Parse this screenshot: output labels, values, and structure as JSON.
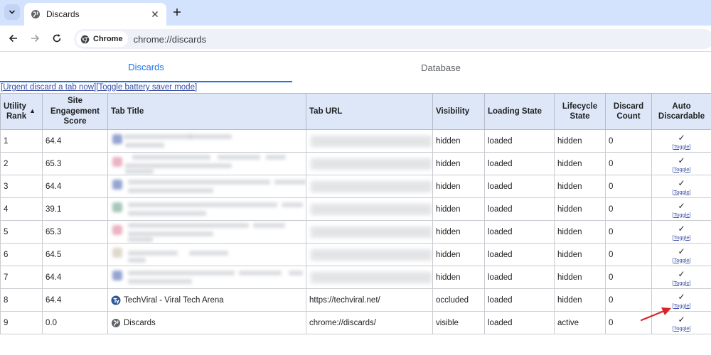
{
  "browser": {
    "tab_title": "Discards",
    "omnibox_chip": "Chrome",
    "url": "chrome://discards"
  },
  "page_tabs": [
    "Discards",
    "Database"
  ],
  "actions": {
    "urgent_discard": "[Urgent discard a tab now]",
    "toggle_battery": "[Toggle battery saver mode]"
  },
  "headers": {
    "utility_rank_1": "Utility",
    "utility_rank_2": "Rank",
    "sort_arrow": "▲",
    "engagement_1": "Site",
    "engagement_2": "Engagement",
    "engagement_3": "Score",
    "tab_title": "Tab Title",
    "tab_url": "Tab URL",
    "visibility": "Visibility",
    "loading_state": "Loading State",
    "lifecycle_1": "Lifecycle",
    "lifecycle_2": "State",
    "discard_1": "Discard",
    "discard_2": "Count",
    "auto_1": "Auto",
    "auto_2": "Discardable"
  },
  "rows": [
    {
      "rank": "1",
      "score": "64.4",
      "title": "",
      "url": "",
      "visibility": "hidden",
      "loading": "loaded",
      "lifecycle": "hidden",
      "discard_count": "0",
      "auto": "✓",
      "toggle": "[Toggle]",
      "fav_color": "#7b8fc7"
    },
    {
      "rank": "2",
      "score": "65.3",
      "title": "",
      "url": "",
      "visibility": "hidden",
      "loading": "loaded",
      "lifecycle": "hidden",
      "discard_count": "0",
      "auto": "✓",
      "toggle": "[Toggle]",
      "fav_color": "#e7a1b5"
    },
    {
      "rank": "3",
      "score": "64.4",
      "title": "",
      "url": "",
      "visibility": "hidden",
      "loading": "loaded",
      "lifecycle": "hidden",
      "discard_count": "0",
      "auto": "✓",
      "toggle": "[Toggle]",
      "fav_color": "#7b8fc7"
    },
    {
      "rank": "4",
      "score": "39.1",
      "title": "",
      "url": "",
      "visibility": "hidden",
      "loading": "loaded",
      "lifecycle": "hidden",
      "discard_count": "0",
      "auto": "✓",
      "toggle": "[Toggle]",
      "fav_color": "#8fb9a8"
    },
    {
      "rank": "5",
      "score": "65.3",
      "title": "",
      "url": "",
      "visibility": "hidden",
      "loading": "loaded",
      "lifecycle": "hidden",
      "discard_count": "0",
      "auto": "✓",
      "toggle": "[Toggle]",
      "fav_color": "#e7a1b5"
    },
    {
      "rank": "6",
      "score": "64.5",
      "title": "",
      "url": "",
      "visibility": "hidden",
      "loading": "loaded",
      "lifecycle": "hidden",
      "discard_count": "0",
      "auto": "✓",
      "toggle": "[Toggle]",
      "fav_color": "#d8d0c0"
    },
    {
      "rank": "7",
      "score": "64.4",
      "title": "",
      "url": "",
      "visibility": "hidden",
      "loading": "loaded",
      "lifecycle": "hidden",
      "discard_count": "0",
      "auto": "✓",
      "toggle": "[Toggle]",
      "fav_color": "#7b8fc7"
    },
    {
      "rank": "8",
      "score": "64.4",
      "title": "TechViral - Viral Tech Arena",
      "url": "https://techviral.net/",
      "visibility": "occluded",
      "loading": "loaded",
      "lifecycle": "hidden",
      "discard_count": "0",
      "auto": "✓",
      "toggle": "[Toggle]",
      "fav_color": "#2b5797"
    },
    {
      "rank": "9",
      "score": "0.0",
      "title": "Discards",
      "url": "chrome://discards/",
      "visibility": "visible",
      "loading": "loaded",
      "lifecycle": "active",
      "discard_count": "0",
      "auto": "✓",
      "toggle": "[Toggle]",
      "fav_color": "#5f6368"
    }
  ],
  "colors": {
    "tabstrip": "#d3e3fd",
    "header_bg": "#dde7f8",
    "accent": "#1a73e8",
    "annotation_arrow": "#d9232b"
  }
}
